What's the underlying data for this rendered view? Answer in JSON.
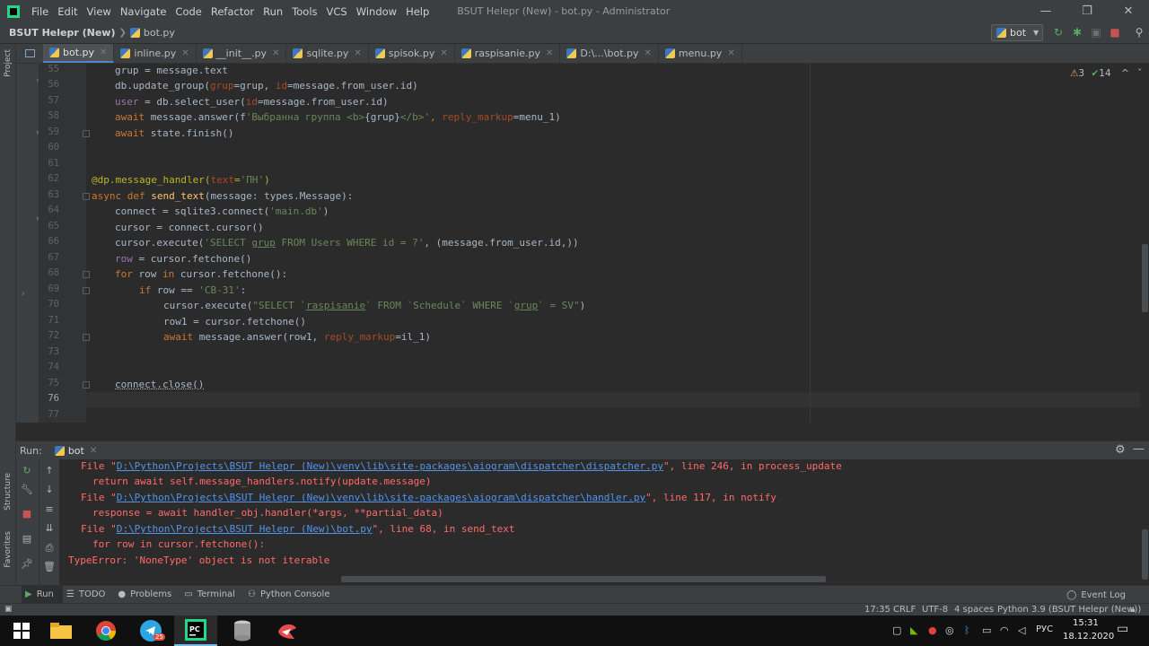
{
  "titlebar": {
    "menu": [
      "File",
      "Edit",
      "View",
      "Navigate",
      "Code",
      "Refactor",
      "Run",
      "Tools",
      "VCS",
      "Window",
      "Help"
    ],
    "window_title": "BSUT Helepr (New) - bot.py - Administrator",
    "minimize": "—",
    "maximize": "❐",
    "close": "✕"
  },
  "navbar": {
    "project": "BSUT Helepr (New)",
    "file": "bot.py",
    "run_config": "bot"
  },
  "left_stripe": {
    "project_label": "Project",
    "structure_label": "Structure",
    "favorites_label": "Favorites"
  },
  "tabs": [
    {
      "label": "bot.py"
    },
    {
      "label": "inline.py"
    },
    {
      "label": "__init__.py"
    },
    {
      "label": "sqlite.py"
    },
    {
      "label": "spisok.py"
    },
    {
      "label": "raspisanie.py"
    },
    {
      "label": "D:\\...\\bot.py"
    },
    {
      "label": "menu.py"
    }
  ],
  "inspection": {
    "warnings": "3",
    "checks": "14"
  },
  "line_numbers": [
    "55",
    "56",
    "57",
    "58",
    "59",
    "60",
    "61",
    "62",
    "63",
    "64",
    "65",
    "66",
    "67",
    "68",
    "69",
    "70",
    "71",
    "72",
    "73",
    "74",
    "75",
    "76",
    "77"
  ],
  "code": {
    "l55": [
      "grup",
      " = message.text"
    ],
    "l56": [
      "db.update_group(",
      "grup",
      "=grup, ",
      "id",
      "=message.from_user.id)"
    ],
    "l57": [
      "user",
      " = db.select_user(",
      "id",
      "=message.from_user.id)"
    ],
    "l58": [
      "await",
      " message.answer(f",
      "'Выбранна группа <b>",
      "{grup}",
      "</b>'",
      ", ",
      "reply_markup",
      "=menu_1)"
    ],
    "l59": [
      "await",
      " state.finish()"
    ],
    "l62": [
      "@dp.message_handler(",
      "text",
      "=",
      "'ПН'",
      ")"
    ],
    "l63": [
      "async def ",
      "send_text",
      "(message: types.Message):"
    ],
    "l64": [
      "connect = sqlite3.connect(",
      "'main.db'",
      ")"
    ],
    "l65": [
      "cursor = connect.cursor()"
    ],
    "l66": [
      "cursor.execute(",
      "'SELECT ",
      "grup",
      " FROM Users WHERE id = ?'",
      ", (message.from_user.id,))"
    ],
    "l67": [
      "row",
      " = cursor.fetchone()"
    ],
    "l68": [
      "for",
      " row ",
      "in",
      " cursor.fetchone():"
    ],
    "l69": [
      "if",
      " row == ",
      "'СВ-31'",
      ":"
    ],
    "l70": [
      "cursor.execute(",
      "\"SELECT `",
      "raspisanie",
      "` FROM `Schedule` WHERE `",
      "grup",
      "` = SV\"",
      ")"
    ],
    "l71": [
      "row1 = cursor.fetchone()"
    ],
    "l72": [
      "await",
      " message.answer(row1, ",
      "reply_markup",
      "=il_1)"
    ],
    "l75": [
      "connect.close()"
    ]
  },
  "run_panel": {
    "title": "Run:",
    "tab": "bot",
    "lines": {
      "c1_pre": "File \"",
      "c1_link": "D:\\Python\\Projects\\BSUT Helepr (New)\\venv\\lib\\site-packages\\aiogram\\dispatcher\\dispatcher.py",
      "c1_post": "\", line 246, in process_update",
      "c2": "return await self.message_handlers.notify(update.message)",
      "c3_pre": "File \"",
      "c3_link": "D:\\Python\\Projects\\BSUT Helepr (New)\\venv\\lib\\site-packages\\aiogram\\dispatcher\\handler.py",
      "c3_post": "\", line 117, in notify",
      "c4": "response = await handler_obj.handler(*args, **partial_data)",
      "c5_pre": "File \"",
      "c5_link": "D:\\Python\\Projects\\BSUT Helepr (New)\\bot.py",
      "c5_post": "\", line 68, in send_text",
      "c6": "for row in cursor.fetchone():",
      "c7": "TypeError: 'NoneType' object is not iterable"
    }
  },
  "toolwindows": {
    "run": "Run",
    "todo": "TODO",
    "problems": "Problems",
    "terminal": "Terminal",
    "python_console": "Python Console",
    "event_log": "Event Log"
  },
  "statusbar": {
    "position": "17:35",
    "line_sep": "CRLF",
    "encoding": "UTF-8",
    "indent": "4 spaces",
    "interpreter": "Python 3.9 (BSUT Helepr (New))"
  },
  "taskbar": {
    "lang": "РУС",
    "time": "15:31",
    "date": "18.12.2020",
    "telegram_badge": "25"
  },
  "colors": {
    "keyword": "#cc7832",
    "function": "#ffc66d",
    "string": "#6a8759",
    "param": "#aa4926",
    "error": "#ff6b68",
    "link": "#5394ec"
  }
}
